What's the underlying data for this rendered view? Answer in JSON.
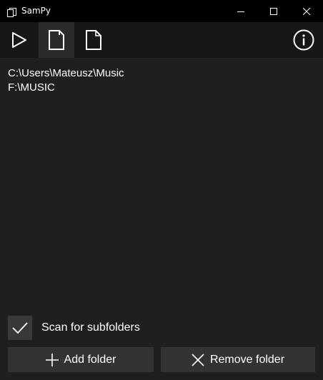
{
  "window": {
    "title": "SamPy"
  },
  "toolbar": {
    "items": [
      {
        "icon": "play-icon"
      },
      {
        "icon": "folder-page-icon",
        "selected": true
      },
      {
        "icon": "file-icon"
      },
      {
        "icon": "info-icon"
      }
    ]
  },
  "folders": [
    "C:\\Users\\Mateusz\\Music",
    "F:\\MUSIC"
  ],
  "scan": {
    "label": "Scan for subfolders",
    "checked": true
  },
  "buttons": {
    "add_label": "Add folder",
    "remove_label": "Remove folder"
  },
  "colors": {
    "background": "#1f1f1f",
    "titlebar": "#000000",
    "toolbar": "#171717",
    "toolbar_selected": "#2b2b2b",
    "button": "#333333",
    "text": "#ffffff"
  }
}
